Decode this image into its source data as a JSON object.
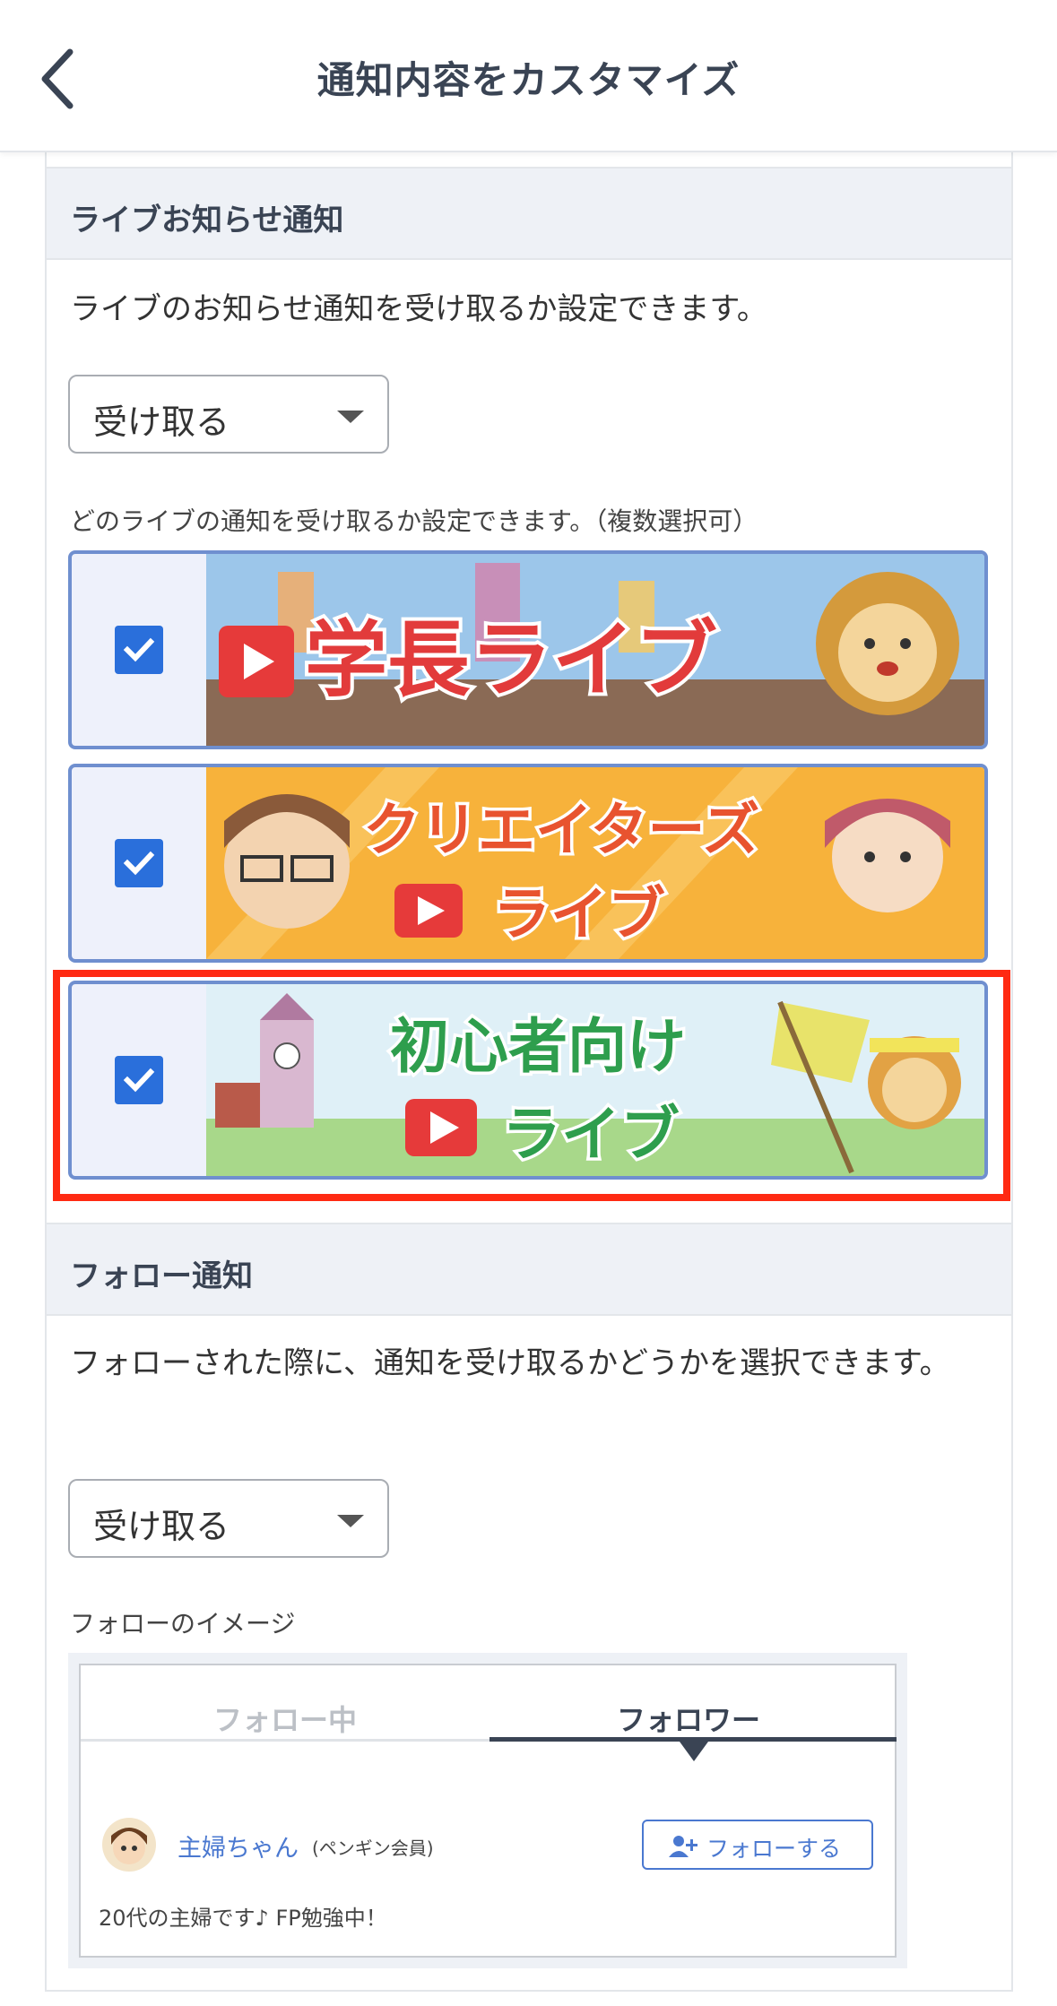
{
  "header": {
    "title": "通知内容をカスタマイズ"
  },
  "live_section": {
    "heading": "ライブお知らせ通知",
    "description": "ライブのお知らせ通知を受け取るか設定できます。",
    "select_value": "受け取る",
    "sub_label": "どのライブの通知を受け取るか設定できます。（複数選択可）",
    "banners": [
      {
        "title": "学長ライブ",
        "checked": true
      },
      {
        "title_line1": "クリエイターズ",
        "title_line2": "ライブ",
        "checked": true
      },
      {
        "title_line1": "初心者向け",
        "title_line2": "ライブ",
        "checked": true
      }
    ]
  },
  "follow_section": {
    "heading": "フォロー通知",
    "description": "フォローされた際に、通知を受け取るかどうかを選択できます。",
    "select_value": "受け取る",
    "image_label": "フォローのイメージ",
    "demo": {
      "tab_following": "フォロー中",
      "tab_followers": "フォロワー",
      "user_name": "主婦ちゃん",
      "user_rank": "(ペンギン会員)",
      "follow_button": "フォローする",
      "bio": "20代の主婦です♪ FP勉強中！"
    }
  },
  "colors": {
    "accent": "#2a6fdb",
    "highlight": "#ff2a12",
    "heading_bg": "#eef1f6"
  }
}
